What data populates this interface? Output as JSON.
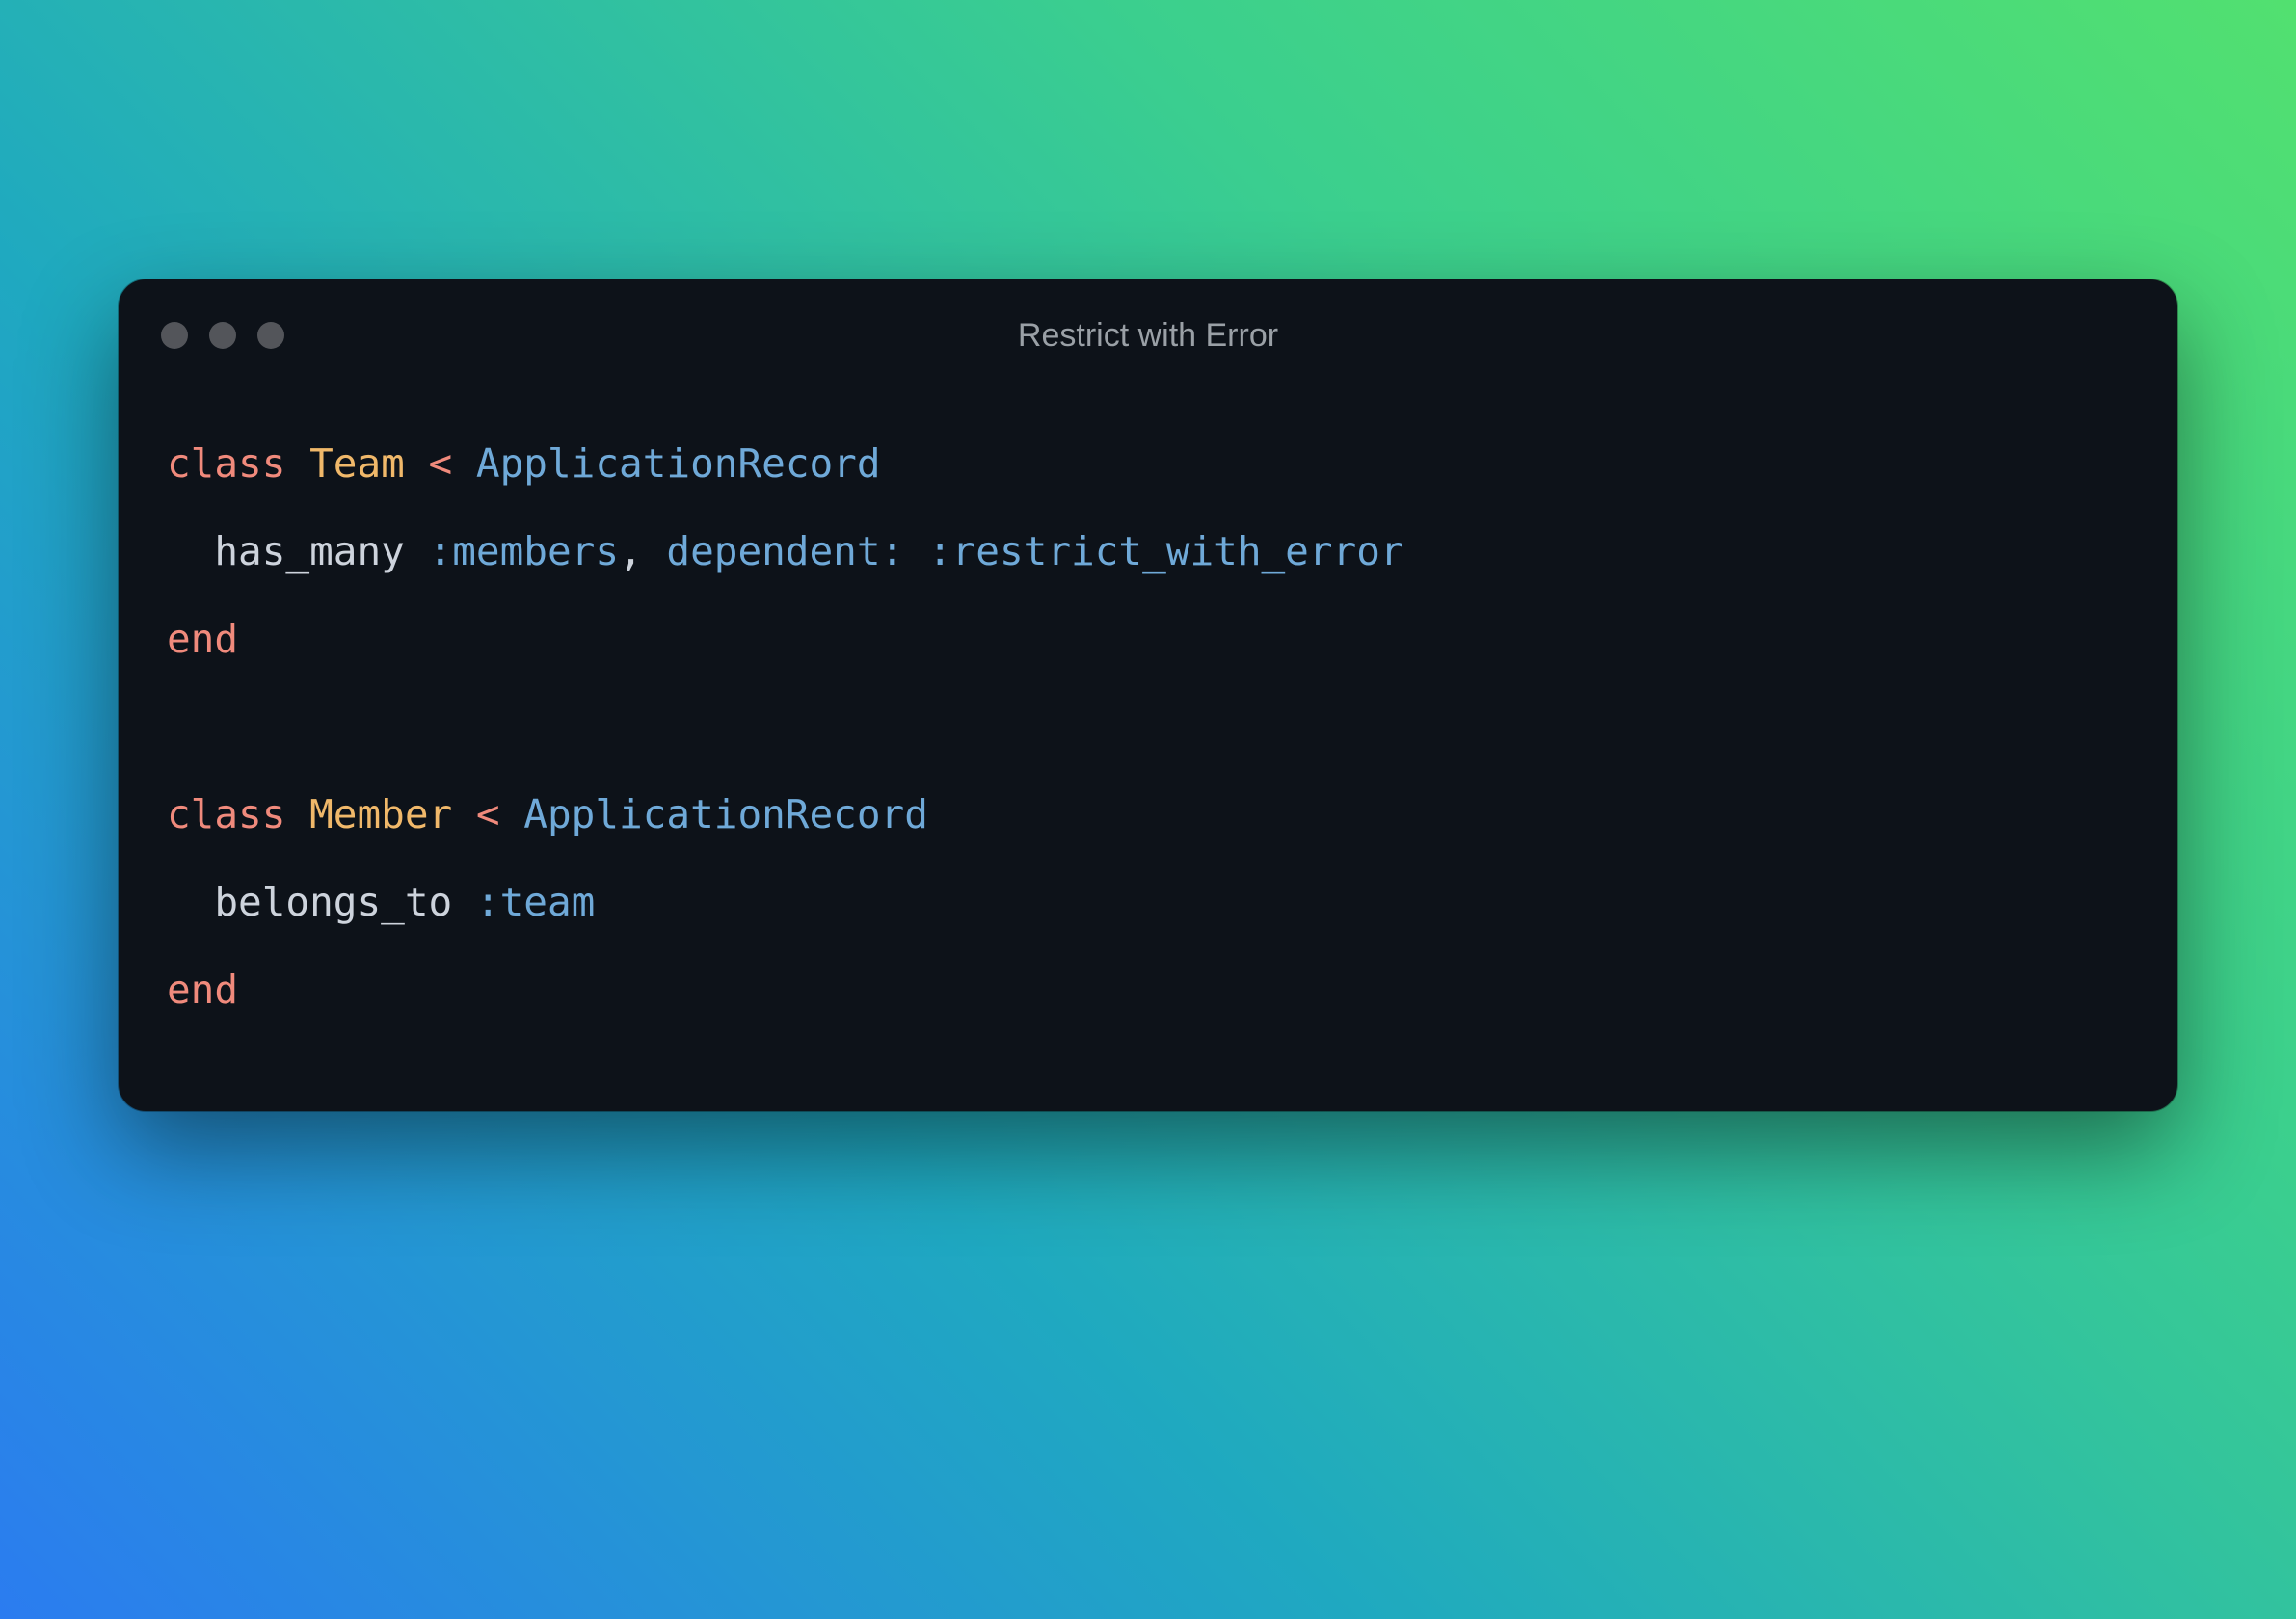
{
  "window": {
    "title": "Restrict with Error"
  },
  "code": {
    "lines": [
      [
        {
          "cls": "kw",
          "text": "class "
        },
        {
          "cls": "cls",
          "text": "Team"
        },
        {
          "cls": "plain",
          "text": " "
        },
        {
          "cls": "op",
          "text": "<"
        },
        {
          "cls": "plain",
          "text": " "
        },
        {
          "cls": "type",
          "text": "ApplicationRecord"
        }
      ],
      [
        {
          "cls": "plain",
          "text": "  has_many "
        },
        {
          "cls": "sym",
          "text": ":members"
        },
        {
          "cls": "plain",
          "text": ", "
        },
        {
          "cls": "sym",
          "text": "dependent:"
        },
        {
          "cls": "plain",
          "text": " "
        },
        {
          "cls": "sym",
          "text": ":restrict_with_error"
        }
      ],
      [
        {
          "cls": "kw",
          "text": "end"
        }
      ],
      [
        {
          "cls": "plain",
          "text": ""
        }
      ],
      [
        {
          "cls": "kw",
          "text": "class "
        },
        {
          "cls": "cls",
          "text": "Member"
        },
        {
          "cls": "plain",
          "text": " "
        },
        {
          "cls": "op",
          "text": "<"
        },
        {
          "cls": "plain",
          "text": " "
        },
        {
          "cls": "type",
          "text": "ApplicationRecord"
        }
      ],
      [
        {
          "cls": "plain",
          "text": "  belongs_to "
        },
        {
          "cls": "sym",
          "text": ":team"
        }
      ],
      [
        {
          "cls": "kw",
          "text": "end"
        }
      ]
    ]
  },
  "colors": {
    "keyword": "#f08a7c",
    "class_name": "#f0b86a",
    "type": "#6fa9d8",
    "symbol": "#6fa9d8",
    "plain": "#cdd3dc",
    "window_bg": "#0d1219",
    "titlebar_text": "#9aa0a6",
    "traffic_dot": "#53555a"
  }
}
